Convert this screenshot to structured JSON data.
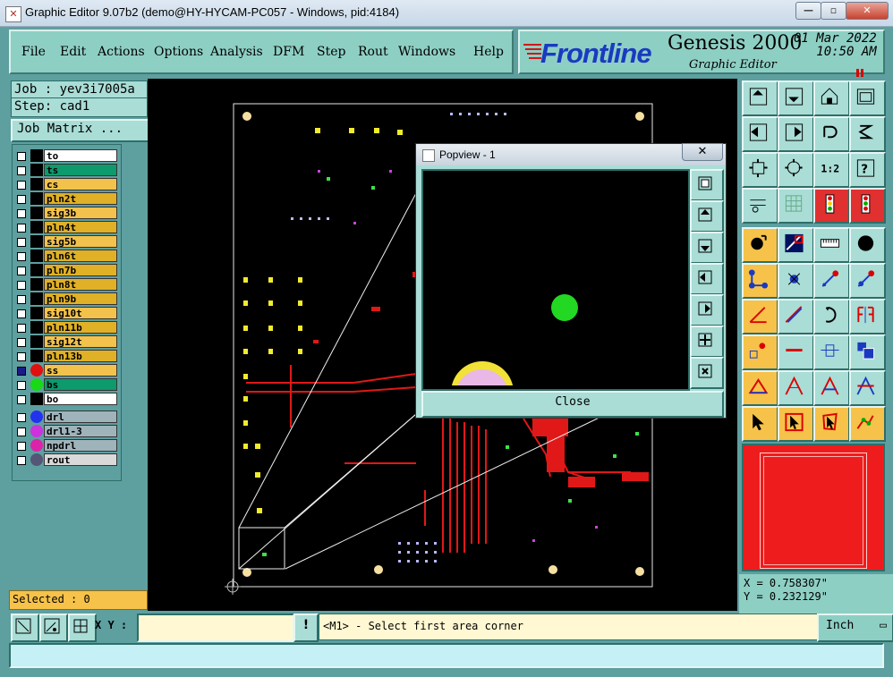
{
  "window": {
    "title": "Graphic Editor 9.07b2 (demo@HY-HYCAM-PC057 - Windows, pid:4184)",
    "minimize": "—",
    "maximize": "▫",
    "close": "✕"
  },
  "menu": [
    "File",
    "Edit",
    "Actions",
    "Options",
    "Analysis",
    "DFM",
    "Step",
    "Rout",
    "Windows",
    "Help"
  ],
  "brand": {
    "logo": "Frontline",
    "product": "Genesis 2000",
    "subtitle": "Graphic Editor",
    "date": "01 Mar 2022",
    "time": "10:50 AM"
  },
  "job": {
    "job": "Job : yev3i7005a",
    "step": "Step: cad1",
    "matrix": "Job Matrix ..."
  },
  "layers": [
    {
      "name": "to",
      "color": "#ffffff",
      "dot": ""
    },
    {
      "name": "ts",
      "color": "#0d9a6c",
      "dot": ""
    },
    {
      "name": "cs",
      "color": "#f2c24c",
      "dot": ""
    },
    {
      "name": "pln2t",
      "color": "#e0b127",
      "dot": ""
    },
    {
      "name": "sig3b",
      "color": "#f2c24c",
      "dot": ""
    },
    {
      "name": "pln4t",
      "color": "#e0b127",
      "dot": ""
    },
    {
      "name": "sig5b",
      "color": "#f2c24c",
      "dot": ""
    },
    {
      "name": "pln6t",
      "color": "#e0b127",
      "dot": ""
    },
    {
      "name": "pln7b",
      "color": "#e0b127",
      "dot": ""
    },
    {
      "name": "pln8t",
      "color": "#e0b127",
      "dot": ""
    },
    {
      "name": "pln9b",
      "color": "#e0b127",
      "dot": ""
    },
    {
      "name": "sig10t",
      "color": "#f2c24c",
      "dot": ""
    },
    {
      "name": "pln11b",
      "color": "#e0b127",
      "dot": ""
    },
    {
      "name": "sig12t",
      "color": "#f2c24c",
      "dot": ""
    },
    {
      "name": "pln13b",
      "color": "#e0b127",
      "dot": ""
    },
    {
      "name": "ss",
      "color": "#f2c24c",
      "dot": "#e01010",
      "active": true
    },
    {
      "name": "bs",
      "color": "#0d9a6c",
      "dot": "#18d818"
    },
    {
      "name": "bo",
      "color": "#ffffff",
      "dot": ""
    }
  ],
  "drill_layers": [
    {
      "name": "drl",
      "color": "#9fb3bb",
      "dot": "#2233ee"
    },
    {
      "name": "drl1-3",
      "color": "#9fb3bb",
      "dot": "#cc33dd"
    },
    {
      "name": "npdrl",
      "color": "#9fb3bb",
      "dot": "#dd22aa"
    },
    {
      "name": "rout",
      "color": "#d9d9d9",
      "dot": "#555577"
    }
  ],
  "selected": "Selected : 0",
  "popview": {
    "title": "Popview - 1",
    "close_x": "✕",
    "close_button": "Close"
  },
  "coordinates": {
    "x": "X = 0.758307\"",
    "y": "Y = 0.232129\""
  },
  "input": {
    "label": "X Y :",
    "value": "",
    "bang": "!"
  },
  "prompt": "<M1> - Select first area corner",
  "units": "Inch",
  "status": ""
}
